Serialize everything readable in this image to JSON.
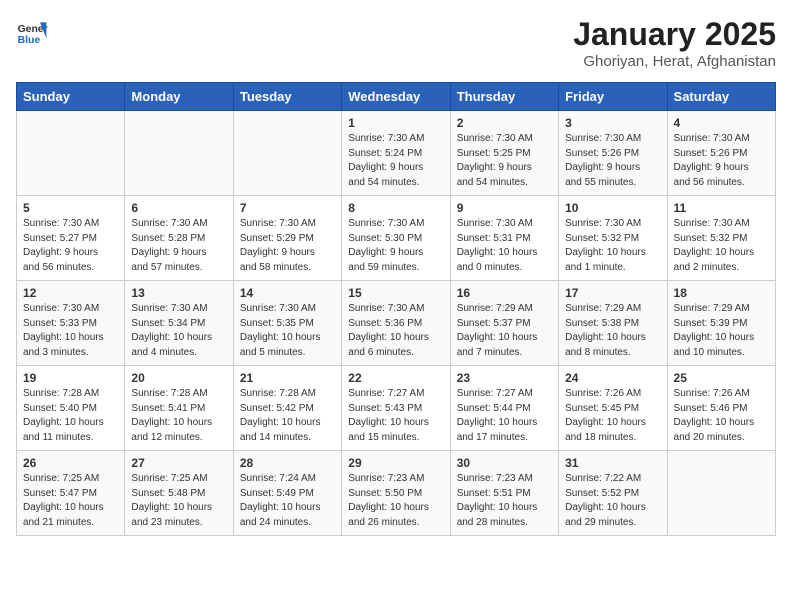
{
  "header": {
    "logo_line1": "General",
    "logo_line2": "Blue",
    "title": "January 2025",
    "subtitle": "Ghoriyan, Herat, Afghanistan"
  },
  "weekdays": [
    "Sunday",
    "Monday",
    "Tuesday",
    "Wednesday",
    "Thursday",
    "Friday",
    "Saturday"
  ],
  "weeks": [
    [
      {
        "day": "",
        "info": ""
      },
      {
        "day": "",
        "info": ""
      },
      {
        "day": "",
        "info": ""
      },
      {
        "day": "1",
        "info": "Sunrise: 7:30 AM\nSunset: 5:24 PM\nDaylight: 9 hours\nand 54 minutes."
      },
      {
        "day": "2",
        "info": "Sunrise: 7:30 AM\nSunset: 5:25 PM\nDaylight: 9 hours\nand 54 minutes."
      },
      {
        "day": "3",
        "info": "Sunrise: 7:30 AM\nSunset: 5:26 PM\nDaylight: 9 hours\nand 55 minutes."
      },
      {
        "day": "4",
        "info": "Sunrise: 7:30 AM\nSunset: 5:26 PM\nDaylight: 9 hours\nand 56 minutes."
      }
    ],
    [
      {
        "day": "5",
        "info": "Sunrise: 7:30 AM\nSunset: 5:27 PM\nDaylight: 9 hours\nand 56 minutes."
      },
      {
        "day": "6",
        "info": "Sunrise: 7:30 AM\nSunset: 5:28 PM\nDaylight: 9 hours\nand 57 minutes."
      },
      {
        "day": "7",
        "info": "Sunrise: 7:30 AM\nSunset: 5:29 PM\nDaylight: 9 hours\nand 58 minutes."
      },
      {
        "day": "8",
        "info": "Sunrise: 7:30 AM\nSunset: 5:30 PM\nDaylight: 9 hours\nand 59 minutes."
      },
      {
        "day": "9",
        "info": "Sunrise: 7:30 AM\nSunset: 5:31 PM\nDaylight: 10 hours\nand 0 minutes."
      },
      {
        "day": "10",
        "info": "Sunrise: 7:30 AM\nSunset: 5:32 PM\nDaylight: 10 hours\nand 1 minute."
      },
      {
        "day": "11",
        "info": "Sunrise: 7:30 AM\nSunset: 5:32 PM\nDaylight: 10 hours\nand 2 minutes."
      }
    ],
    [
      {
        "day": "12",
        "info": "Sunrise: 7:30 AM\nSunset: 5:33 PM\nDaylight: 10 hours\nand 3 minutes."
      },
      {
        "day": "13",
        "info": "Sunrise: 7:30 AM\nSunset: 5:34 PM\nDaylight: 10 hours\nand 4 minutes."
      },
      {
        "day": "14",
        "info": "Sunrise: 7:30 AM\nSunset: 5:35 PM\nDaylight: 10 hours\nand 5 minutes."
      },
      {
        "day": "15",
        "info": "Sunrise: 7:30 AM\nSunset: 5:36 PM\nDaylight: 10 hours\nand 6 minutes."
      },
      {
        "day": "16",
        "info": "Sunrise: 7:29 AM\nSunset: 5:37 PM\nDaylight: 10 hours\nand 7 minutes."
      },
      {
        "day": "17",
        "info": "Sunrise: 7:29 AM\nSunset: 5:38 PM\nDaylight: 10 hours\nand 8 minutes."
      },
      {
        "day": "18",
        "info": "Sunrise: 7:29 AM\nSunset: 5:39 PM\nDaylight: 10 hours\nand 10 minutes."
      }
    ],
    [
      {
        "day": "19",
        "info": "Sunrise: 7:28 AM\nSunset: 5:40 PM\nDaylight: 10 hours\nand 11 minutes."
      },
      {
        "day": "20",
        "info": "Sunrise: 7:28 AM\nSunset: 5:41 PM\nDaylight: 10 hours\nand 12 minutes."
      },
      {
        "day": "21",
        "info": "Sunrise: 7:28 AM\nSunset: 5:42 PM\nDaylight: 10 hours\nand 14 minutes."
      },
      {
        "day": "22",
        "info": "Sunrise: 7:27 AM\nSunset: 5:43 PM\nDaylight: 10 hours\nand 15 minutes."
      },
      {
        "day": "23",
        "info": "Sunrise: 7:27 AM\nSunset: 5:44 PM\nDaylight: 10 hours\nand 17 minutes."
      },
      {
        "day": "24",
        "info": "Sunrise: 7:26 AM\nSunset: 5:45 PM\nDaylight: 10 hours\nand 18 minutes."
      },
      {
        "day": "25",
        "info": "Sunrise: 7:26 AM\nSunset: 5:46 PM\nDaylight: 10 hours\nand 20 minutes."
      }
    ],
    [
      {
        "day": "26",
        "info": "Sunrise: 7:25 AM\nSunset: 5:47 PM\nDaylight: 10 hours\nand 21 minutes."
      },
      {
        "day": "27",
        "info": "Sunrise: 7:25 AM\nSunset: 5:48 PM\nDaylight: 10 hours\nand 23 minutes."
      },
      {
        "day": "28",
        "info": "Sunrise: 7:24 AM\nSunset: 5:49 PM\nDaylight: 10 hours\nand 24 minutes."
      },
      {
        "day": "29",
        "info": "Sunrise: 7:23 AM\nSunset: 5:50 PM\nDaylight: 10 hours\nand 26 minutes."
      },
      {
        "day": "30",
        "info": "Sunrise: 7:23 AM\nSunset: 5:51 PM\nDaylight: 10 hours\nand 28 minutes."
      },
      {
        "day": "31",
        "info": "Sunrise: 7:22 AM\nSunset: 5:52 PM\nDaylight: 10 hours\nand 29 minutes."
      },
      {
        "day": "",
        "info": ""
      }
    ]
  ]
}
